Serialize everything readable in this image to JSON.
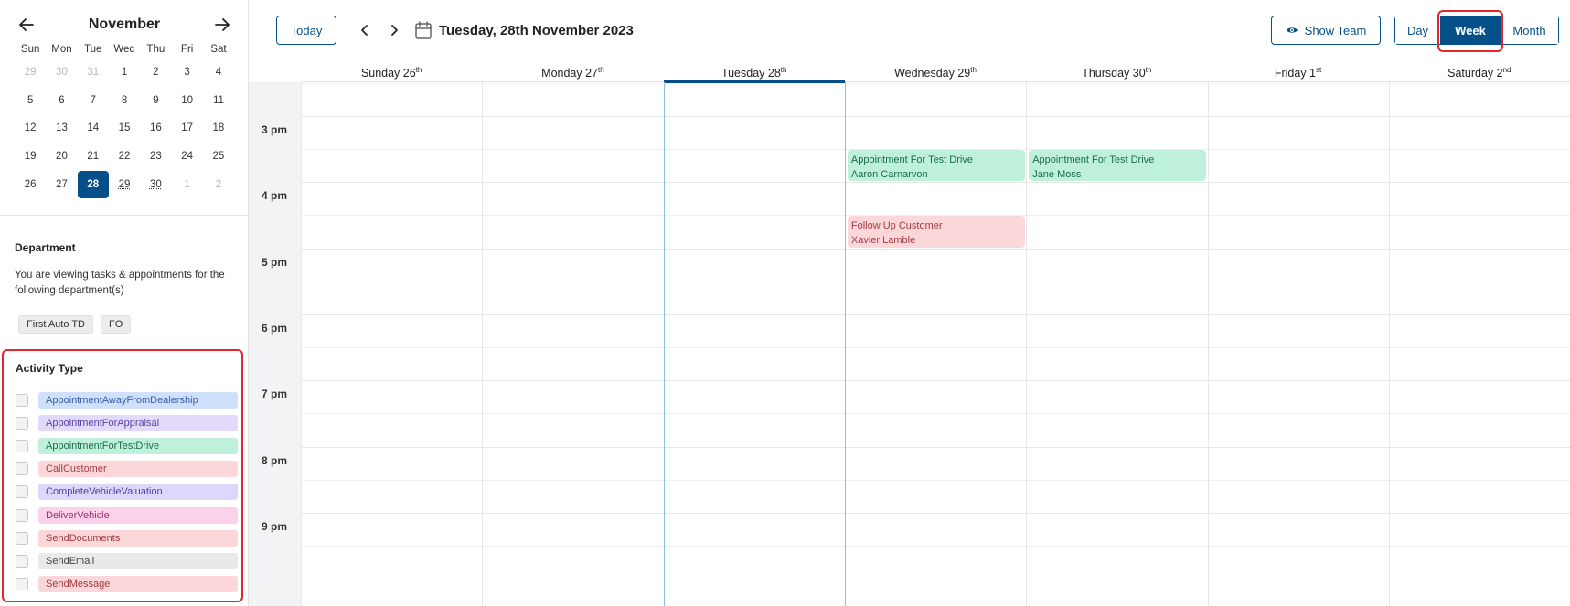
{
  "mini_calendar": {
    "month": "November",
    "weekdays": [
      "Sun",
      "Mon",
      "Tue",
      "Wed",
      "Thu",
      "Fri",
      "Sat"
    ],
    "days": [
      {
        "n": "29",
        "other": true
      },
      {
        "n": "30",
        "other": true
      },
      {
        "n": "31",
        "other": true
      },
      {
        "n": "1"
      },
      {
        "n": "2"
      },
      {
        "n": "3"
      },
      {
        "n": "4"
      },
      {
        "n": "5"
      },
      {
        "n": "6"
      },
      {
        "n": "7"
      },
      {
        "n": "8"
      },
      {
        "n": "9"
      },
      {
        "n": "10"
      },
      {
        "n": "11"
      },
      {
        "n": "12"
      },
      {
        "n": "13"
      },
      {
        "n": "14"
      },
      {
        "n": "15"
      },
      {
        "n": "16"
      },
      {
        "n": "17"
      },
      {
        "n": "18"
      },
      {
        "n": "19"
      },
      {
        "n": "20"
      },
      {
        "n": "21"
      },
      {
        "n": "22"
      },
      {
        "n": "23"
      },
      {
        "n": "24"
      },
      {
        "n": "25"
      },
      {
        "n": "26"
      },
      {
        "n": "27"
      },
      {
        "n": "28",
        "selected": true
      },
      {
        "n": "29",
        "dotted": true
      },
      {
        "n": "30",
        "dotted": true
      },
      {
        "n": "1",
        "other": true
      },
      {
        "n": "2",
        "other": true
      }
    ]
  },
  "department": {
    "title": "Department",
    "description": "You are viewing tasks & appointments for the following department(s)",
    "tags": [
      "First Auto TD",
      "FO"
    ]
  },
  "activity_type": {
    "title": "Activity Type",
    "items": [
      {
        "label": "AppointmentAwayFromDealership",
        "bg": "#cfe0fb",
        "color": "#3a5da8"
      },
      {
        "label": "AppointmentForAppraisal",
        "bg": "#e3d9fb",
        "color": "#5b3fa8"
      },
      {
        "label": "AppointmentForTestDrive",
        "bg": "#bff0dc",
        "color": "#1a6b4e"
      },
      {
        "label": "CallCustomer",
        "bg": "#fcd7d9",
        "color": "#a23a44"
      },
      {
        "label": "CompleteVehicleValuation",
        "bg": "#dcd7fb",
        "color": "#4f40a8"
      },
      {
        "label": "DeliverVehicle",
        "bg": "#fbd2ea",
        "color": "#9c2f72"
      },
      {
        "label": "SendDocuments",
        "bg": "#fcd7d9",
        "color": "#a23a44"
      },
      {
        "label": "SendEmail",
        "bg": "#e9e9e9",
        "color": "#444444"
      },
      {
        "label": "SendMessage",
        "bg": "#fcd7d9",
        "color": "#a23a44"
      }
    ]
  },
  "toolbar": {
    "today_label": "Today",
    "current_date": "Tuesday, 28th November 2023",
    "show_team_label": "Show Team",
    "views": {
      "day": "Day",
      "week": "Week",
      "month": "Month"
    }
  },
  "week": {
    "days": [
      {
        "name": "Sunday 26",
        "suffix": "th"
      },
      {
        "name": "Monday 27",
        "suffix": "th"
      },
      {
        "name": "Tuesday 28",
        "suffix": "th",
        "today": true
      },
      {
        "name": "Wednesday 29",
        "suffix": "th"
      },
      {
        "name": "Thursday 30",
        "suffix": "th"
      },
      {
        "name": "Friday 1",
        "suffix": "st"
      },
      {
        "name": "Saturday 2",
        "suffix": "nd"
      }
    ],
    "time_labels": [
      "3 pm",
      "4 pm",
      "5 pm",
      "6 pm",
      "7 pm",
      "8 pm",
      "9 pm"
    ],
    "events": [
      {
        "day": 3,
        "start": 15.5,
        "end": 16.0,
        "title": "Appointment For Test Drive",
        "person": "Aaron Carnarvon",
        "kind": "green"
      },
      {
        "day": 4,
        "start": 15.5,
        "end": 16.0,
        "title": "Appointment For Test Drive",
        "person": "Jane Moss",
        "kind": "green"
      },
      {
        "day": 3,
        "start": 16.5,
        "end": 17.0,
        "title": "Follow Up Customer",
        "person": "Xavier Lamble",
        "kind": "red"
      }
    ]
  }
}
